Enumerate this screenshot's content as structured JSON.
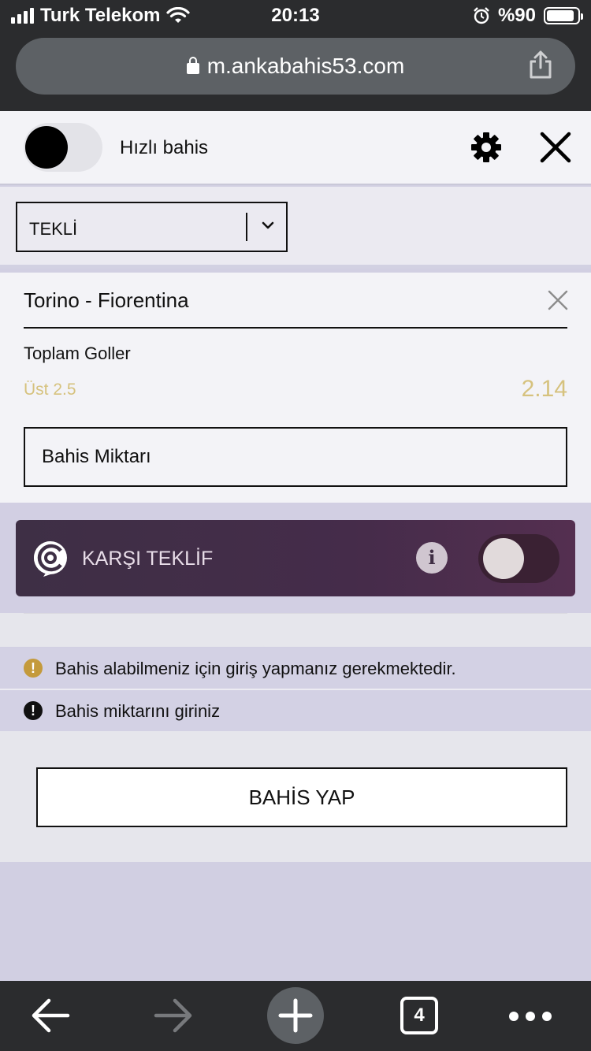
{
  "status_bar": {
    "carrier": "Turk Telekom",
    "time": "20:13",
    "battery": "%90",
    "battery_level": 0.9
  },
  "browser": {
    "url": "m.ankabahis53.com",
    "open_tabs": "4"
  },
  "header": {
    "quick_bet_label": "Hızlı bahis",
    "quick_bet_on": false
  },
  "bet_type": {
    "selected": "TEKLİ"
  },
  "bet": {
    "match": "Torino - Fiorentina",
    "market": "Toplam Goller",
    "selection": "Üst 2.5",
    "odds": "2.14",
    "stake_placeholder": "Bahis Miktarı"
  },
  "counter_offer": {
    "label": "KARŞI TEKLİF",
    "enabled": false
  },
  "messages": {
    "login_required": "Bahis alabilmeniz için giriş yapmanız gerekmektedir.",
    "enter_stake": "Bahis miktarını giriniz"
  },
  "actions": {
    "place_bet": "BAHİS YAP"
  },
  "colors": {
    "chrome": "#2b2c2e",
    "odds_gold": "#d6c27e",
    "counter_card": "#452c4a",
    "warning": "#c49a3b"
  }
}
